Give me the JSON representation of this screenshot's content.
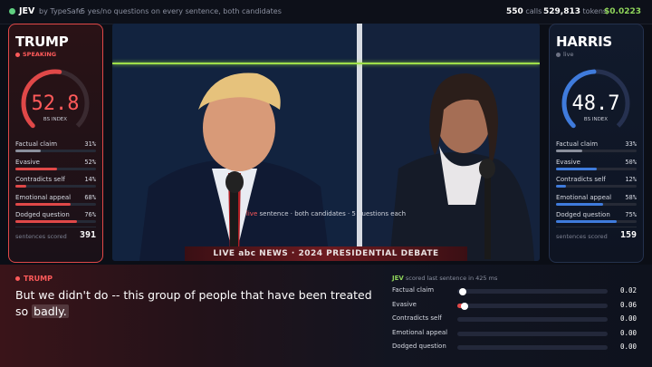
{
  "topbar": {
    "brand": "JEV",
    "by": "by TypeSafe",
    "separator": "·",
    "description": "5 yes/no questions on every sentence, both candidates",
    "calls_value": "550",
    "calls_label": "calls",
    "tokens_value": "529,813",
    "tokens_label": "tokens",
    "cost": "$0.0223"
  },
  "trump": {
    "name": "TRUMP",
    "status": "SPEAKING",
    "score": "52.8",
    "score_fraction": 0.528,
    "index_label": "BS INDEX",
    "metrics": [
      {
        "label": "Factual claim",
        "pct": "31%",
        "value": 0.31
      },
      {
        "label": "Evasive",
        "pct": "52%",
        "value": 0.52
      },
      {
        "label": "Contradicts self",
        "pct": "14%",
        "value": 0.14
      },
      {
        "label": "Emotional appeal",
        "pct": "68%",
        "value": 0.68
      },
      {
        "label": "Dodged question",
        "pct": "76%",
        "value": 0.76
      }
    ],
    "scored_label": "sentences scored",
    "scored": "391",
    "accent": "#e04848"
  },
  "harris": {
    "name": "HARRIS",
    "status": "live",
    "score": "48.7",
    "score_fraction": 0.487,
    "index_label": "BS INDEX",
    "metrics": [
      {
        "label": "Factual claim",
        "pct": "33%",
        "value": 0.33
      },
      {
        "label": "Evasive",
        "pct": "50%",
        "value": 0.5
      },
      {
        "label": "Contradicts self",
        "pct": "12%",
        "value": 0.12
      },
      {
        "label": "Emotional appeal",
        "pct": "58%",
        "value": 0.58
      },
      {
        "label": "Dodged question",
        "pct": "75%",
        "value": 0.75
      }
    ],
    "scored_label": "sentences scored",
    "scored": "159",
    "accent": "#3f7bdc"
  },
  "video": {
    "caption_hl": "live",
    "caption_rest": " sentence · both candidates · 5 questions each",
    "banner": "LIVE abc NEWS · 2024 PRESIDENTIAL DEBATE"
  },
  "transcript": {
    "speaker": "TRUMP",
    "text_main": "But we didn't do -- this group of people that have been treated so",
    "text_last": "badly."
  },
  "jev_panel": {
    "brand": "JEV",
    "note": "scored last sentence in 425 ms",
    "rows": [
      {
        "label": "Factual claim",
        "val": "0.02",
        "value": 0.02
      },
      {
        "label": "Evasive",
        "val": "0.06",
        "value": 0.06
      },
      {
        "label": "Contradicts self",
        "val": "0.00",
        "value": 0.0
      },
      {
        "label": "Emotional appeal",
        "val": "0.00",
        "value": 0.0
      },
      {
        "label": "Dodged question",
        "val": "0.00",
        "value": 0.0
      }
    ]
  }
}
